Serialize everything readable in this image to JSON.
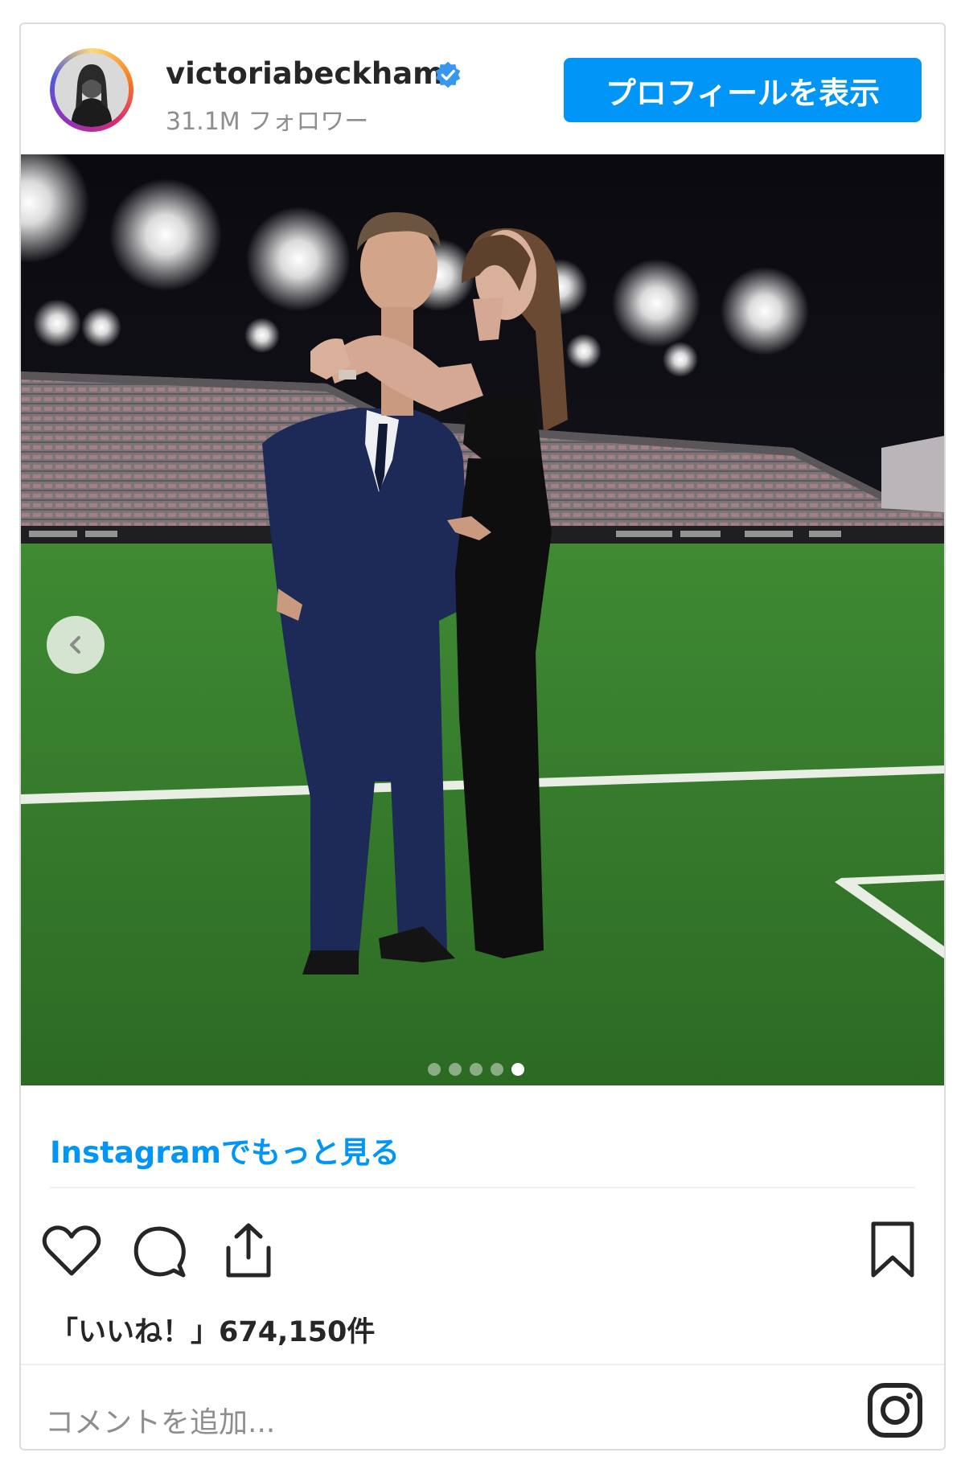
{
  "header": {
    "username": "victoriabeckham",
    "followers": "31.1M フォロワー",
    "profile_button": "プロフィールを表示"
  },
  "post": {
    "carousel": {
      "total_slides": 5,
      "active_slide": 5
    },
    "more_link": "Instagramでもっと見る",
    "likes": "「いいね！」674,150件"
  },
  "comment": {
    "placeholder": "コメントを追加..."
  },
  "icons": [
    "verified-badge-icon",
    "chevron-left-icon",
    "heart-icon",
    "comment-icon",
    "share-icon",
    "bookmark-icon",
    "instagram-icon"
  ],
  "colors": {
    "accent": "#0095f6",
    "text": "#262626",
    "muted": "#8e8e8e",
    "border": "#dbdbdb"
  }
}
